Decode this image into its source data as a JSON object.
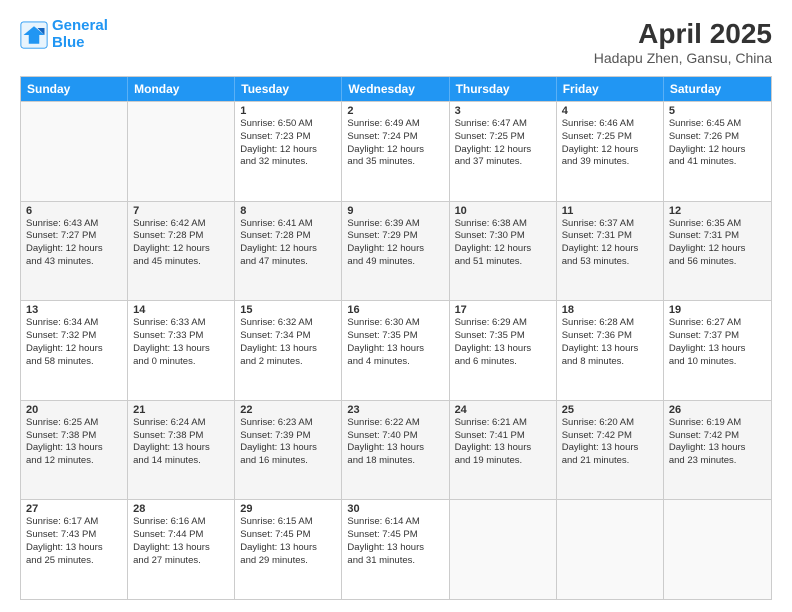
{
  "logo": {
    "line1": "General",
    "line2": "Blue"
  },
  "title": "April 2025",
  "location": "Hadapu Zhen, Gansu, China",
  "header_days": [
    "Sunday",
    "Monday",
    "Tuesday",
    "Wednesday",
    "Thursday",
    "Friday",
    "Saturday"
  ],
  "rows": [
    [
      {
        "day": "",
        "lines": [],
        "empty": true
      },
      {
        "day": "",
        "lines": [],
        "empty": true
      },
      {
        "day": "1",
        "lines": [
          "Sunrise: 6:50 AM",
          "Sunset: 7:23 PM",
          "Daylight: 12 hours",
          "and 32 minutes."
        ]
      },
      {
        "day": "2",
        "lines": [
          "Sunrise: 6:49 AM",
          "Sunset: 7:24 PM",
          "Daylight: 12 hours",
          "and 35 minutes."
        ]
      },
      {
        "day": "3",
        "lines": [
          "Sunrise: 6:47 AM",
          "Sunset: 7:25 PM",
          "Daylight: 12 hours",
          "and 37 minutes."
        ]
      },
      {
        "day": "4",
        "lines": [
          "Sunrise: 6:46 AM",
          "Sunset: 7:25 PM",
          "Daylight: 12 hours",
          "and 39 minutes."
        ]
      },
      {
        "day": "5",
        "lines": [
          "Sunrise: 6:45 AM",
          "Sunset: 7:26 PM",
          "Daylight: 12 hours",
          "and 41 minutes."
        ]
      }
    ],
    [
      {
        "day": "6",
        "lines": [
          "Sunrise: 6:43 AM",
          "Sunset: 7:27 PM",
          "Daylight: 12 hours",
          "and 43 minutes."
        ]
      },
      {
        "day": "7",
        "lines": [
          "Sunrise: 6:42 AM",
          "Sunset: 7:28 PM",
          "Daylight: 12 hours",
          "and 45 minutes."
        ]
      },
      {
        "day": "8",
        "lines": [
          "Sunrise: 6:41 AM",
          "Sunset: 7:28 PM",
          "Daylight: 12 hours",
          "and 47 minutes."
        ]
      },
      {
        "day": "9",
        "lines": [
          "Sunrise: 6:39 AM",
          "Sunset: 7:29 PM",
          "Daylight: 12 hours",
          "and 49 minutes."
        ]
      },
      {
        "day": "10",
        "lines": [
          "Sunrise: 6:38 AM",
          "Sunset: 7:30 PM",
          "Daylight: 12 hours",
          "and 51 minutes."
        ]
      },
      {
        "day": "11",
        "lines": [
          "Sunrise: 6:37 AM",
          "Sunset: 7:31 PM",
          "Daylight: 12 hours",
          "and 53 minutes."
        ]
      },
      {
        "day": "12",
        "lines": [
          "Sunrise: 6:35 AM",
          "Sunset: 7:31 PM",
          "Daylight: 12 hours",
          "and 56 minutes."
        ]
      }
    ],
    [
      {
        "day": "13",
        "lines": [
          "Sunrise: 6:34 AM",
          "Sunset: 7:32 PM",
          "Daylight: 12 hours",
          "and 58 minutes."
        ]
      },
      {
        "day": "14",
        "lines": [
          "Sunrise: 6:33 AM",
          "Sunset: 7:33 PM",
          "Daylight: 13 hours",
          "and 0 minutes."
        ]
      },
      {
        "day": "15",
        "lines": [
          "Sunrise: 6:32 AM",
          "Sunset: 7:34 PM",
          "Daylight: 13 hours",
          "and 2 minutes."
        ]
      },
      {
        "day": "16",
        "lines": [
          "Sunrise: 6:30 AM",
          "Sunset: 7:35 PM",
          "Daylight: 13 hours",
          "and 4 minutes."
        ]
      },
      {
        "day": "17",
        "lines": [
          "Sunrise: 6:29 AM",
          "Sunset: 7:35 PM",
          "Daylight: 13 hours",
          "and 6 minutes."
        ]
      },
      {
        "day": "18",
        "lines": [
          "Sunrise: 6:28 AM",
          "Sunset: 7:36 PM",
          "Daylight: 13 hours",
          "and 8 minutes."
        ]
      },
      {
        "day": "19",
        "lines": [
          "Sunrise: 6:27 AM",
          "Sunset: 7:37 PM",
          "Daylight: 13 hours",
          "and 10 minutes."
        ]
      }
    ],
    [
      {
        "day": "20",
        "lines": [
          "Sunrise: 6:25 AM",
          "Sunset: 7:38 PM",
          "Daylight: 13 hours",
          "and 12 minutes."
        ]
      },
      {
        "day": "21",
        "lines": [
          "Sunrise: 6:24 AM",
          "Sunset: 7:38 PM",
          "Daylight: 13 hours",
          "and 14 minutes."
        ]
      },
      {
        "day": "22",
        "lines": [
          "Sunrise: 6:23 AM",
          "Sunset: 7:39 PM",
          "Daylight: 13 hours",
          "and 16 minutes."
        ]
      },
      {
        "day": "23",
        "lines": [
          "Sunrise: 6:22 AM",
          "Sunset: 7:40 PM",
          "Daylight: 13 hours",
          "and 18 minutes."
        ]
      },
      {
        "day": "24",
        "lines": [
          "Sunrise: 6:21 AM",
          "Sunset: 7:41 PM",
          "Daylight: 13 hours",
          "and 19 minutes."
        ]
      },
      {
        "day": "25",
        "lines": [
          "Sunrise: 6:20 AM",
          "Sunset: 7:42 PM",
          "Daylight: 13 hours",
          "and 21 minutes."
        ]
      },
      {
        "day": "26",
        "lines": [
          "Sunrise: 6:19 AM",
          "Sunset: 7:42 PM",
          "Daylight: 13 hours",
          "and 23 minutes."
        ]
      }
    ],
    [
      {
        "day": "27",
        "lines": [
          "Sunrise: 6:17 AM",
          "Sunset: 7:43 PM",
          "Daylight: 13 hours",
          "and 25 minutes."
        ]
      },
      {
        "day": "28",
        "lines": [
          "Sunrise: 6:16 AM",
          "Sunset: 7:44 PM",
          "Daylight: 13 hours",
          "and 27 minutes."
        ]
      },
      {
        "day": "29",
        "lines": [
          "Sunrise: 6:15 AM",
          "Sunset: 7:45 PM",
          "Daylight: 13 hours",
          "and 29 minutes."
        ]
      },
      {
        "day": "30",
        "lines": [
          "Sunrise: 6:14 AM",
          "Sunset: 7:45 PM",
          "Daylight: 13 hours",
          "and 31 minutes."
        ]
      },
      {
        "day": "",
        "lines": [],
        "empty": true
      },
      {
        "day": "",
        "lines": [],
        "empty": true
      },
      {
        "day": "",
        "lines": [],
        "empty": true
      }
    ]
  ]
}
